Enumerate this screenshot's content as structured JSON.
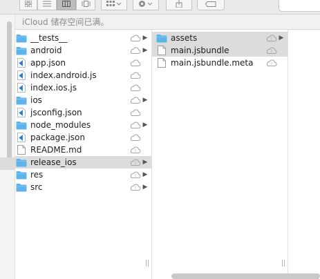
{
  "banner": {
    "text": "iCloud 储存空间已满。"
  },
  "column1": {
    "items": [
      {
        "label": "__tests__",
        "icon": "folder-icon",
        "cloud": "cloud-icon",
        "arrow": true,
        "selected": false
      },
      {
        "label": "android",
        "icon": "folder-icon",
        "cloud": "cloud-icon",
        "arrow": true,
        "selected": false
      },
      {
        "label": "app.json",
        "icon": "vscode-file-icon",
        "cloud": "cloud-icon",
        "arrow": false,
        "selected": false
      },
      {
        "label": "index.android.js",
        "icon": "vscode-file-icon",
        "cloud": "cloud-icon",
        "arrow": false,
        "selected": false
      },
      {
        "label": "index.ios.js",
        "icon": "vscode-file-icon",
        "cloud": "cloud-icon",
        "arrow": false,
        "selected": false
      },
      {
        "label": "ios",
        "icon": "folder-icon",
        "cloud": "cloud-icon",
        "arrow": true,
        "selected": false
      },
      {
        "label": "jsconfig.json",
        "icon": "vscode-file-icon",
        "cloud": "cloud-icon",
        "arrow": false,
        "selected": false
      },
      {
        "label": "node_modules",
        "icon": "folder-icon",
        "cloud": "cloud-icon",
        "arrow": true,
        "selected": false
      },
      {
        "label": "package.json",
        "icon": "vscode-file-icon",
        "cloud": "cloud-icon",
        "arrow": false,
        "selected": false
      },
      {
        "label": "README.md",
        "icon": "document-icon",
        "cloud": "cloud-pending-icon",
        "arrow": false,
        "selected": false
      },
      {
        "label": "release_ios",
        "icon": "folder-icon",
        "cloud": "cloud-pending-icon",
        "arrow": true,
        "selected": true
      },
      {
        "label": "res",
        "icon": "folder-icon",
        "cloud": "cloud-pending-icon",
        "arrow": true,
        "selected": false
      },
      {
        "label": "src",
        "icon": "folder-icon",
        "cloud": "cloud-pending-icon",
        "arrow": true,
        "selected": false
      }
    ]
  },
  "column2": {
    "items": [
      {
        "label": "assets",
        "icon": "folder-icon",
        "cloud": "cloud-pending-icon",
        "arrow": true,
        "selected": true
      },
      {
        "label": "main.jsbundle",
        "icon": "document-icon",
        "cloud": "cloud-pending-icon",
        "arrow": false,
        "selected": true
      },
      {
        "label": "main.jsbundle.meta",
        "icon": "document-icon",
        "cloud": "cloud-pending-icon",
        "arrow": false,
        "selected": false
      }
    ]
  },
  "colors": {
    "folder": "#5cb4ea",
    "folder_tab": "#7ac6f2",
    "vscode": "#2a7bd6",
    "selected_row": "#dcdcdc"
  }
}
